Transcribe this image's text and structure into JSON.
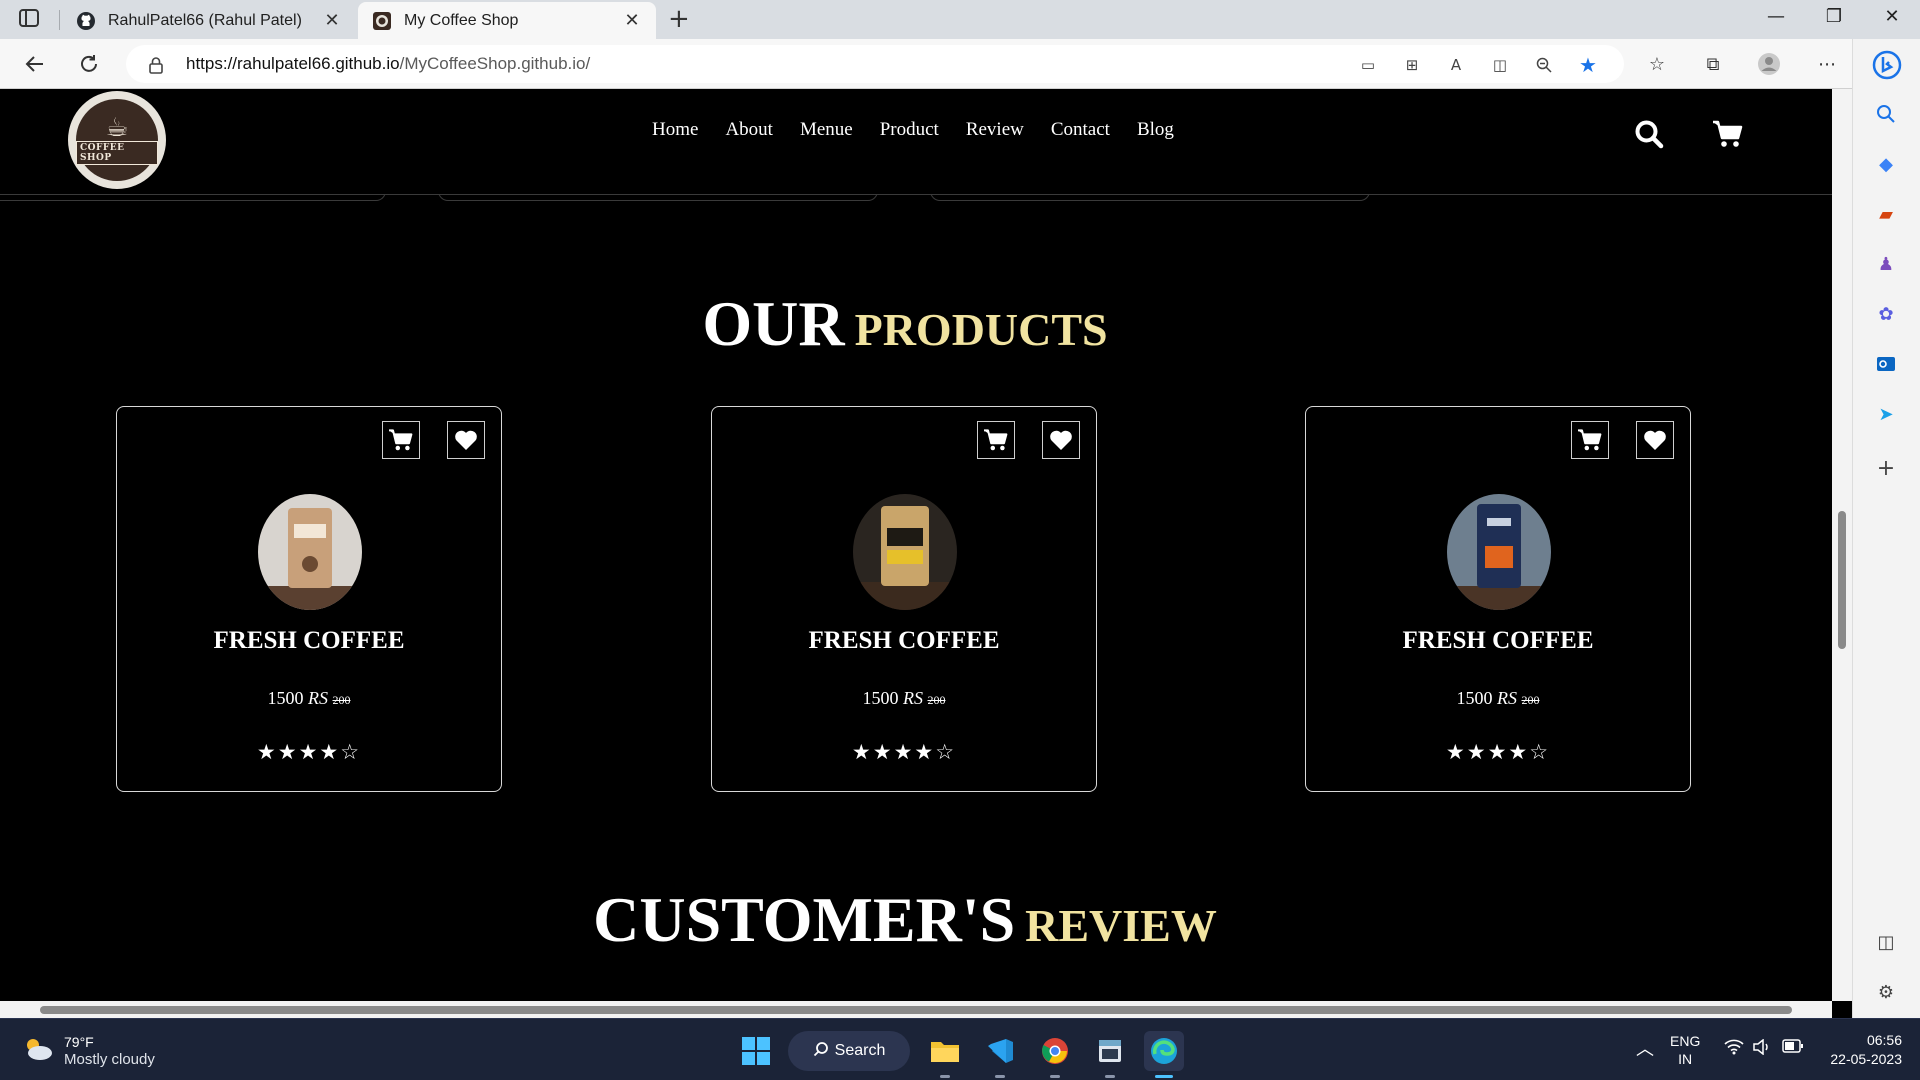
{
  "browser": {
    "tabs": [
      {
        "title": "RahulPatel66 (Rahul Patel)",
        "active": false,
        "favicon": "github-icon"
      },
      {
        "title": "My Coffee Shop",
        "active": true,
        "favicon": "coffee-shop-icon"
      }
    ],
    "new_tab": "+",
    "window_controls": {
      "minimize": "—",
      "maximize": "❐",
      "close": "✕"
    },
    "url_scheme_host": "https://rahulpatel66.github.io",
    "url_path": "/MyCoffeeShop.github.io/",
    "favorited": true,
    "accent_color": "#1a73e8"
  },
  "site": {
    "logo_text": "COFFEE SHOP",
    "nav": [
      "Home",
      "About",
      "Menue",
      "Product",
      "Review",
      "Contact",
      "Blog"
    ],
    "products_heading": {
      "big": "OUR",
      "small": "PRODUCTS"
    },
    "products": [
      {
        "name": "FRESH COFFEE",
        "price": "1500",
        "currency": "RS",
        "old_price": "200",
        "rating": 4,
        "max_rating": 5,
        "stars": "★★★★☆"
      },
      {
        "name": "FRESH COFFEE",
        "price": "1500",
        "currency": "RS",
        "old_price": "200",
        "rating": 4,
        "max_rating": 5,
        "stars": "★★★★☆"
      },
      {
        "name": "FRESH COFFEE",
        "price": "1500",
        "currency": "RS",
        "old_price": "200",
        "rating": 4,
        "max_rating": 5,
        "stars": "★★★★☆"
      }
    ],
    "review_heading": {
      "big": "CUSTOMER'S",
      "small": "REVIEW"
    },
    "heading_accent_color": "#f1e3a0"
  },
  "taskbar": {
    "weather_temp": "79°F",
    "weather_condition": "Mostly cloudy",
    "search_label": "Search",
    "language": "ENG",
    "region": "IN",
    "time": "06:56",
    "date": "22-05-2023"
  }
}
